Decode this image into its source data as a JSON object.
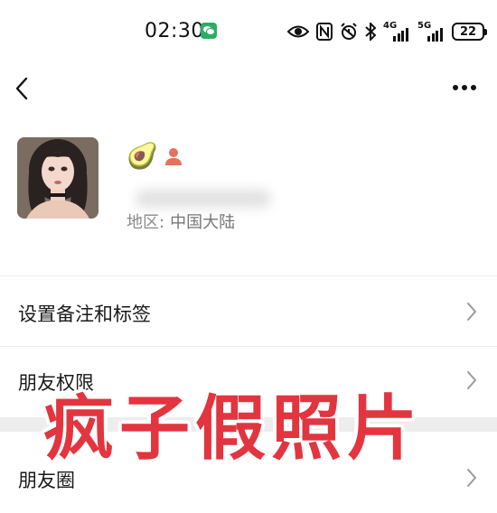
{
  "status_bar": {
    "time": "02:30",
    "net_4g": "4G",
    "net_5g": "5G",
    "battery": "22",
    "icons": [
      "wechat-icon",
      "eye-icon",
      "nfc-icon",
      "alarm-icon",
      "bluetooth-icon",
      "signal-4g-icon",
      "signal-5g-icon",
      "battery-icon"
    ]
  },
  "nav": {
    "back_icon": "chevron-left-icon",
    "more_icon": "more-dots-icon"
  },
  "profile": {
    "name_emoji": "🥑",
    "gender_icon": "person-icon",
    "region_label": "地区:",
    "region_value": "中国大陆"
  },
  "menu": {
    "items": [
      {
        "label": "设置备注和标签"
      },
      {
        "label": "朋友权限"
      },
      {
        "label": "朋友圈"
      }
    ]
  },
  "overlay": {
    "text": "疯子假照片"
  },
  "colors": {
    "overlay_red": "#e2353f",
    "wechat_green": "#2aae67",
    "person_orange": "#e9705a",
    "divider": "#ececec",
    "muted_text": "#8a8a8a"
  }
}
